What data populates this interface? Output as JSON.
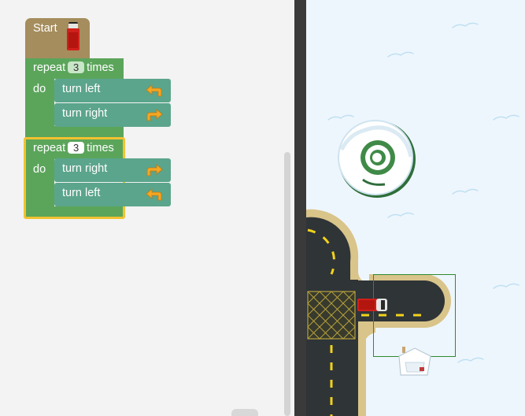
{
  "workspace": {
    "start_block": {
      "label": "Start",
      "icon": "red-car-icon"
    },
    "repeat_blocks": [
      {
        "repeat_label": "repeat",
        "count": "3",
        "times_label": "times",
        "do_label": "do",
        "statements": [
          {
            "label": "turn left",
            "icon": "turn-left-arrow-icon"
          },
          {
            "label": "turn right",
            "icon": "turn-right-arrow-icon"
          }
        ]
      },
      {
        "repeat_label": "repeat",
        "count": "3",
        "times_label": "times",
        "do_label": "do",
        "selected": true,
        "statements": [
          {
            "label": "turn right",
            "icon": "turn-right-arrow-icon"
          },
          {
            "label": "turn left",
            "icon": "turn-left-arrow-icon"
          }
        ]
      }
    ]
  },
  "stage": {
    "background": "snow",
    "objects": [
      "snowy-tree-icon",
      "road-intersection",
      "red-truck-icon",
      "snow-house-icon",
      "finish-marker"
    ]
  },
  "colors": {
    "start_block": "#a58d5d",
    "repeat_block": "#5ba55b",
    "turn_block": "#5ba58c",
    "selection": "#f2c230",
    "arrow": "#f5a623",
    "road": "#2f3437",
    "road_edge": "#d9c48a",
    "lane_marking": "#f2d21b"
  }
}
